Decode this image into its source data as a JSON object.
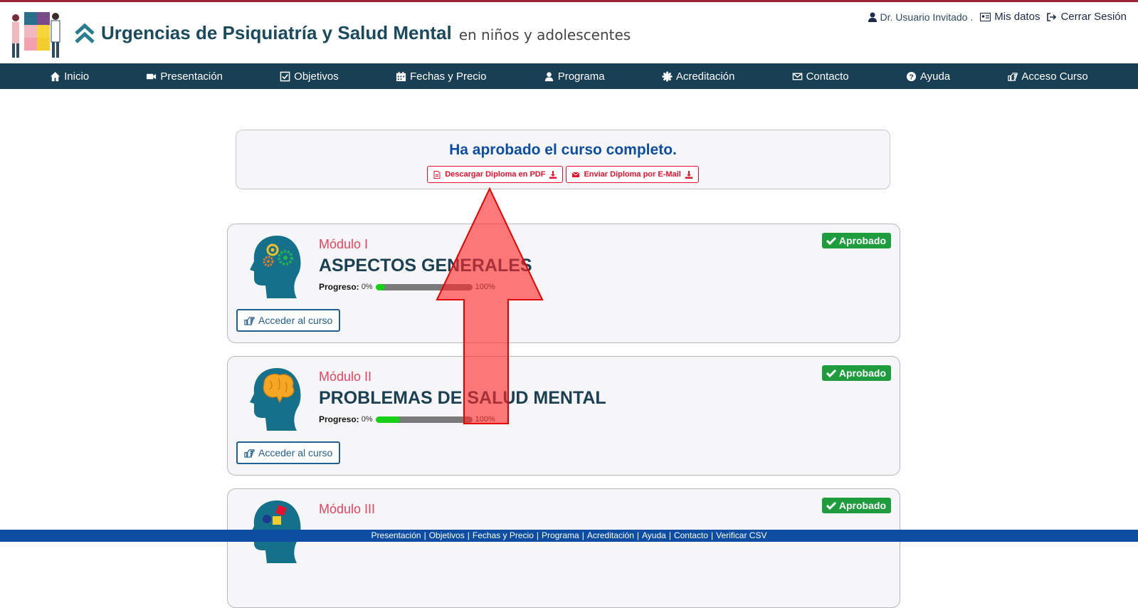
{
  "header": {
    "title": "Urgencias de Psiquiatría y Salud Mental",
    "subtitle": "en niños y adolescentes",
    "user_name": "Dr. Usuario Invitado .",
    "my_data": "Mis datos",
    "logout": "Cerrar Sesión"
  },
  "nav": [
    {
      "label": "Inicio",
      "icon": "home-icon"
    },
    {
      "label": "Presentación",
      "icon": "video-icon"
    },
    {
      "label": "Objetivos",
      "icon": "checkbox-icon"
    },
    {
      "label": "Fechas y Precio",
      "icon": "calendar-icon"
    },
    {
      "label": "Programa",
      "icon": "user-icon"
    },
    {
      "label": "Acreditación",
      "icon": "certificate-icon"
    },
    {
      "label": "Contacto",
      "icon": "envelope-icon"
    },
    {
      "label": "Ayuda",
      "icon": "question-icon"
    },
    {
      "label": "Acceso Curso",
      "icon": "hand-point-icon"
    }
  ],
  "approved": {
    "message": "Ha aprobado el curso completo.",
    "pdf_button": "Descargar Diploma en PDF",
    "email_button": "Enviar Diploma por E-Mail"
  },
  "modules": [
    {
      "number": "Módulo I",
      "title": "ASPECTOS GENERALES",
      "status": "Aprobado",
      "progress_label": "Progreso:",
      "min": "0%",
      "max": "100%",
      "progress": 0.1,
      "button": "Acceder al curso"
    },
    {
      "number": "Módulo II",
      "title": "PROBLEMAS DE SALUD MENTAL",
      "status": "Aprobado",
      "progress_label": "Progreso:",
      "min": "0%",
      "max": "100%",
      "progress": 0.25,
      "button": "Acceder al curso"
    },
    {
      "number": "Módulo III",
      "title": "",
      "status": "Aprobado"
    }
  ],
  "footer": [
    "Presentación",
    "Objetivos",
    "Fechas y Precio",
    "Programa",
    "Acreditación",
    "Ayuda",
    "Contacto",
    "Verificar CSV"
  ],
  "colors": {
    "nav_bg": "#183f53",
    "approved_green": "#1f9d3e",
    "accent_red": "#e8112d",
    "footer_blue": "#0d4ea3"
  }
}
